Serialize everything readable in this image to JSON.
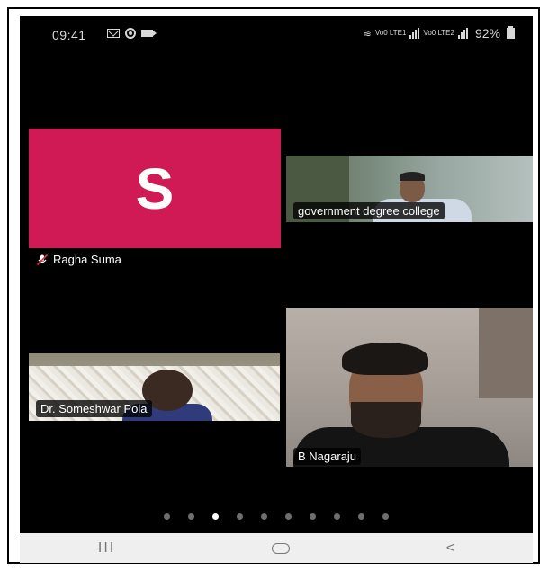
{
  "status_bar": {
    "time": "09:41",
    "network_1": "Vo0 LTE1",
    "network_2": "Vo0 LTE2",
    "battery": "92%"
  },
  "participants": [
    {
      "name": "Ragha Suma",
      "initial": "S",
      "avatar_color": "#cf1a55",
      "muted": true
    },
    {
      "name": "government degree college"
    },
    {
      "name": "Dr. Someshwar Pola"
    },
    {
      "name": "B Nagaraju"
    }
  ],
  "pager": {
    "total": 10,
    "active_index": 2
  },
  "nav": {
    "recent": "III",
    "back": "<"
  },
  "colors": {
    "background": "#000000",
    "avatar": "#cf1a55",
    "navbar": "#efefef"
  }
}
